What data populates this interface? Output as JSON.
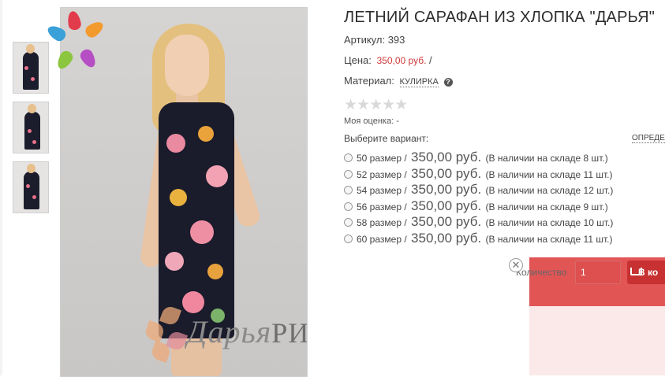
{
  "product": {
    "title": "ЛЕТНИЙ САРАФАН ИЗ ХЛОПКА \"ДАРЬЯ\"",
    "sku_label": "Артикул:",
    "sku_value": "393",
    "price_label": "Цена:",
    "price_value": "350,00 руб.",
    "price_sep": "/",
    "material_label": "Материал:",
    "material_value": "КУЛИРКА",
    "help_icon_glyph": "?",
    "rating_stars": "★★★★★",
    "rating_value": 0,
    "rating_max": 5,
    "my_rating": "Моя оценка: -",
    "choose_variant": "Выберите вариант:",
    "define_size_link": "ОПРЕДЕЛ"
  },
  "variants": [
    {
      "size": "50 размер",
      "sep": "/",
      "price": "350,00 руб.",
      "stock": "(В наличии на складе 8 шт.)"
    },
    {
      "size": "52 размер",
      "sep": "/",
      "price": "350,00 руб.",
      "stock": "(В наличии на складе 11 шт.)"
    },
    {
      "size": "54 размер",
      "sep": "/",
      "price": "350,00 руб.",
      "stock": "(В наличии на складе 12 шт.)"
    },
    {
      "size": "56 размер",
      "sep": "/",
      "price": "350,00 руб.",
      "stock": "(В наличии на складе 9 шт.)"
    },
    {
      "size": "58 размер",
      "sep": "/",
      "price": "350,00 руб.",
      "stock": "(В наличии на складе 10 шт.)"
    },
    {
      "size": "60 размер",
      "sep": "/",
      "price": "350,00 руб.",
      "stock": "(В наличии на складе 11 шт.)"
    }
  ],
  "cart": {
    "qty_label": "Количество",
    "qty_value": "1",
    "add_label": "В ко",
    "close_glyph": "✕"
  },
  "watermark": {
    "text_script": "Дарья",
    "text_plain": "РИО"
  },
  "colors": {
    "price_red": "#d13a3a",
    "popup_red": "#e25555",
    "button_red": "#c73131",
    "dress_navy": "#1a1b2b"
  },
  "icons": [
    "help-icon",
    "star-icon",
    "radio-icon",
    "cart-icon",
    "close-icon"
  ]
}
